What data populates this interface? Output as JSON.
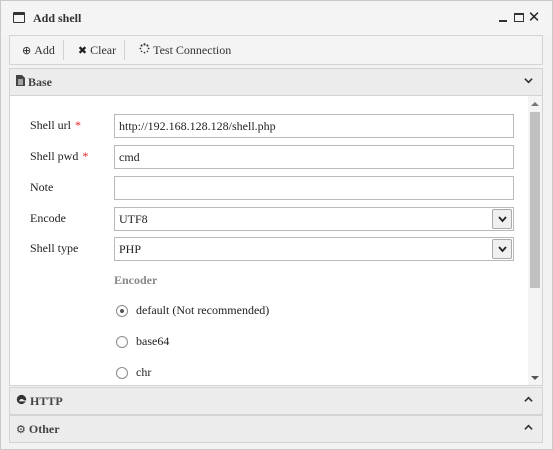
{
  "window": {
    "title": "Add shell",
    "controls": {
      "minimize": "minimize",
      "maximize": "maximize",
      "close": "close"
    }
  },
  "toolbar": {
    "add_label": "Add",
    "clear_label": "Clear",
    "test_label": "Test Connection",
    "add_icon": "plus-circle-icon",
    "clear_icon": "x-icon",
    "test_icon": "spinner-icon"
  },
  "sections": {
    "base": {
      "label": "Base",
      "icon": "document-icon",
      "expanded": true
    },
    "http": {
      "label": "HTTP",
      "icon": "edge-browser-icon",
      "expanded": false
    },
    "other": {
      "label": "Other",
      "icon": "cogs-icon",
      "expanded": false
    }
  },
  "form": {
    "shell_url": {
      "label": "Shell url",
      "required_mark": "*",
      "value": "http://192.168.128.128/shell.php"
    },
    "shell_pwd": {
      "label": "Shell pwd",
      "required_mark": "*",
      "value": "cmd"
    },
    "note": {
      "label": "Note",
      "value": ""
    },
    "encode": {
      "label": "Encode",
      "value": "UTF8"
    },
    "shell_type": {
      "label": "Shell type",
      "value": "PHP"
    },
    "encoder": {
      "label": "Encoder",
      "options": [
        {
          "label": "default (Not recommended)",
          "selected": true
        },
        {
          "label": "base64",
          "selected": false
        },
        {
          "label": "chr",
          "selected": false
        }
      ]
    }
  },
  "colors": {
    "required": "#e02020",
    "section_label": "#888888",
    "scroll_thumb": "#c1c1c1"
  }
}
